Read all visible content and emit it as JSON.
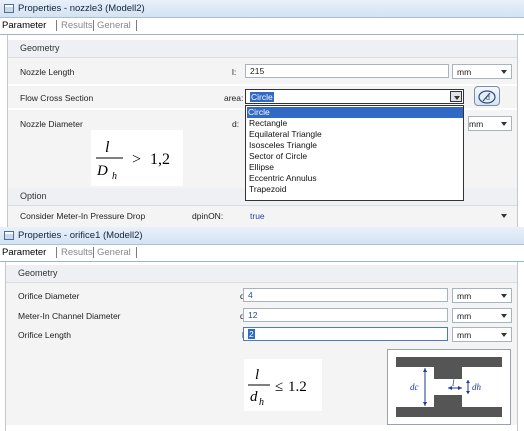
{
  "nozzle_window": {
    "title": "Properties - nozzle3 (Modell2)",
    "tabs": [
      "Parameter",
      "Results",
      "General"
    ],
    "geometry_header": "Geometry",
    "rows": [
      {
        "label": "Nozzle Length",
        "symbol": "l:",
        "value": "215",
        "unit": "mm"
      },
      {
        "label": "Flow Cross Section",
        "symbol": "area:",
        "value": "Circle"
      },
      {
        "label": "Nozzle Diameter",
        "symbol": "d:",
        "value": "",
        "unit": "mm"
      }
    ],
    "dropdown_options": [
      "Circle",
      "Rectangle",
      "Equilateral Triangle",
      "Isosceles Triangle",
      "Sector of Circle",
      "Ellipse",
      "Eccentric Annulus",
      "Trapezoid"
    ],
    "dropdown_selected": "Circle",
    "formula": {
      "numerator": "l",
      "denominator": "D",
      "denominator_sub": "h",
      "relation": ">",
      "rhs": "1,2"
    },
    "option_header": "Option",
    "option_row": {
      "label": "Consider Meter-In Pressure Drop",
      "symbol": "dpinON:",
      "value": "true"
    }
  },
  "orifice_window": {
    "title": "Properties - orifice1 (Modell2)",
    "tabs": [
      "Parameter",
      "Results",
      "General"
    ],
    "geometry_header": "Geometry",
    "rows": [
      {
        "label": "Orifice Diameter",
        "symbol": "dh:",
        "value": "4",
        "unit": "mm"
      },
      {
        "label": "Meter-In Channel Diameter",
        "symbol": "dc:",
        "value": "12",
        "unit": "mm"
      },
      {
        "label": "Orifice Length",
        "symbol": "l:",
        "value": "2",
        "unit": "mm"
      }
    ],
    "formula": {
      "numerator": "l",
      "denominator": "d",
      "denominator_sub": "h",
      "relation": "≤",
      "rhs": "1.2"
    },
    "diagram_labels": {
      "dc": "dc",
      "l": "l",
      "dh": "dh"
    }
  }
}
